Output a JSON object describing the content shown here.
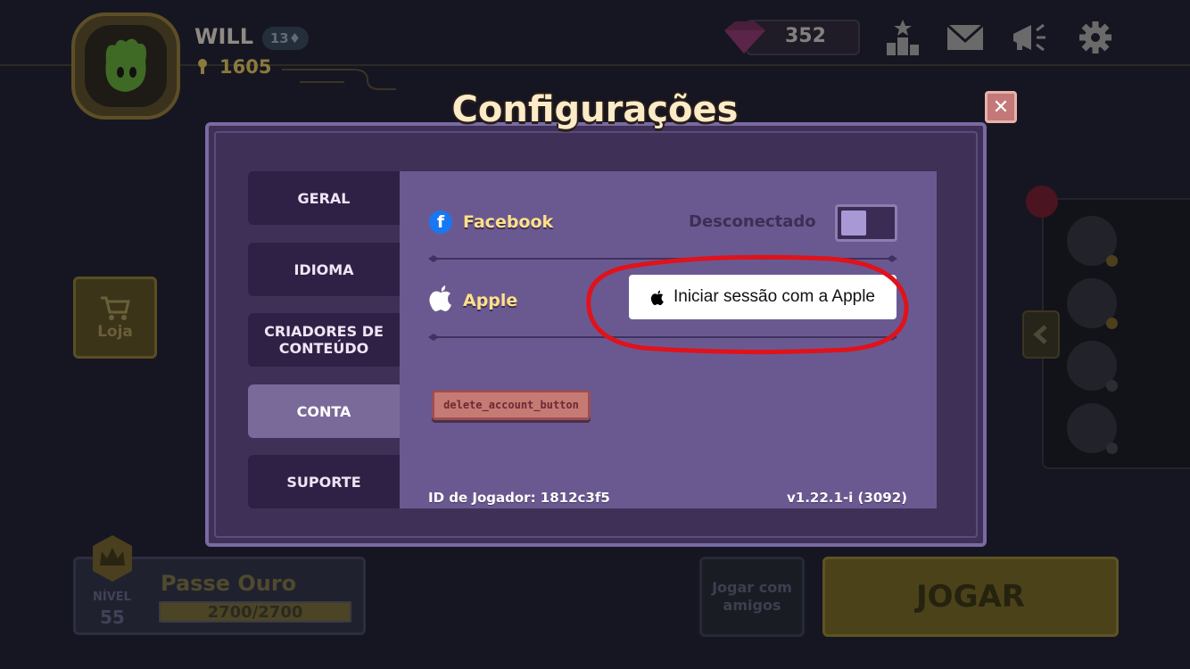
{
  "player": {
    "name": "WILL",
    "level_chip": "13",
    "trophies": "1605",
    "gems": "352"
  },
  "topbar": {
    "icons": [
      "ranking-icon",
      "mail-icon",
      "announcement-icon",
      "settings-gear-icon"
    ]
  },
  "sidebar_left": {
    "shop_label": "Loja"
  },
  "bottom": {
    "pass": {
      "level_label": "NÍVEL",
      "level": "55",
      "title": "Passe Ouro",
      "progress_text": "2700/2700",
      "progress_fraction": 1.0
    },
    "friends_label": "Jogar com amigos",
    "play_label": "JOGAR"
  },
  "modal": {
    "title": "Configurações",
    "tabs": [
      {
        "label": "GERAL",
        "active": false
      },
      {
        "label": "IDIOMA",
        "active": false
      },
      {
        "label": "CRIADORES DE CONTEÚDO",
        "active": false
      },
      {
        "label": "CONTA",
        "active": true
      },
      {
        "label": "SUPORTE",
        "active": false
      }
    ],
    "facebook": {
      "label": "Facebook",
      "status": "Desconectado",
      "connected": false
    },
    "apple": {
      "label": "Apple",
      "button_label": "Iniciar sessão com a Apple"
    },
    "delete_label": "delete_account_button",
    "player_id": "ID de Jogador: 1812c3f5",
    "version": "v1.22.1-i (3092)"
  },
  "colors": {
    "panel": "#6a5990",
    "tab_inactive": "#2f2145",
    "tab_active": "#7a6a99",
    "label_yellow": "#ffe08a",
    "annotation_red": "#e0121b"
  }
}
